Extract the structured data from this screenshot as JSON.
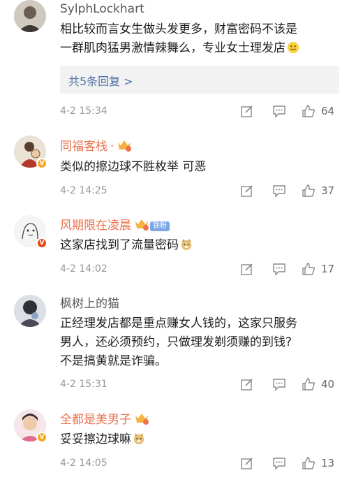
{
  "comments": [
    {
      "name": "SylphLockhart",
      "text_lines": [
        "相比较而言女生做头发更多，财富密码不该是",
        "一群肌肉猛男激情辣舞么，专业女士理发店"
      ],
      "reply_label": "共5条回复 >",
      "time": "4-2 15:34",
      "likes": "64"
    },
    {
      "name": "同福客栈",
      "name_suffix": "·",
      "text_lines": [
        "类似的擦边球不胜枚举 可恶"
      ],
      "time": "4-2 14:25",
      "likes": "37"
    },
    {
      "name": "风期限在凌晨",
      "fan_tag": "铁粉",
      "text_lines": [
        "这家店找到了流量密码"
      ],
      "time": "4-2 14:02",
      "likes": "17"
    },
    {
      "name": "枫树上的猫",
      "text_lines": [
        "正经理发店都是重点赚女人钱的，这家只服务",
        "男人，还必须预约，只做理发剃须赚的到钱?",
        "不是搞黄就是诈骗。"
      ],
      "time": "4-2 15:31",
      "likes": "40"
    },
    {
      "name": "全都是美男子",
      "text_lines": [
        "妥妥擦边球嘛"
      ],
      "time": "4-2 14:05",
      "likes": "13"
    }
  ],
  "icons": {
    "edit": "edit-icon",
    "comment": "comment-icon",
    "like": "thumbs-up-icon"
  },
  "colors": {
    "orange_name": "#eb7350",
    "reply_link": "#4e6fa6",
    "meta_gray": "#999999"
  }
}
